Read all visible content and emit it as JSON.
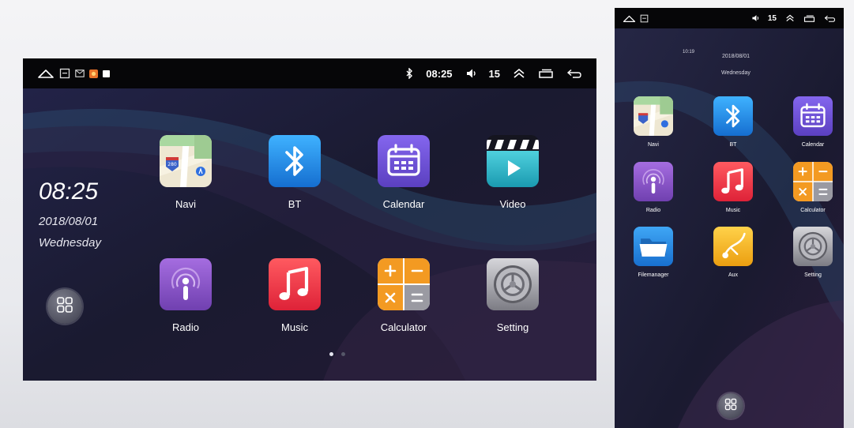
{
  "landscape": {
    "status": {
      "time": "08:25",
      "volume": "15"
    },
    "clock": {
      "time": "08:25",
      "date": "2018/08/01",
      "day": "Wednesday"
    },
    "apps": [
      {
        "label": "Navi",
        "icon": "map-icon"
      },
      {
        "label": "BT",
        "icon": "bluetooth-icon"
      },
      {
        "label": "Calendar",
        "icon": "calendar-icon"
      },
      {
        "label": "Video",
        "icon": "video-icon"
      },
      {
        "label": "Radio",
        "icon": "radio-icon"
      },
      {
        "label": "Music",
        "icon": "music-icon"
      },
      {
        "label": "Calculator",
        "icon": "calculator-icon"
      },
      {
        "label": "Setting",
        "icon": "settings-gear-icon"
      }
    ],
    "page_indicator": {
      "pages": 2,
      "current": 1
    }
  },
  "portrait": {
    "status": {
      "volume": "15"
    },
    "clock": {
      "time": "10:19",
      "date": "2018/08/01",
      "day": "Wednesday"
    },
    "apps": [
      {
        "label": "Navi",
        "icon": "map-icon"
      },
      {
        "label": "BT",
        "icon": "bluetooth-icon"
      },
      {
        "label": "Calendar",
        "icon": "calendar-icon"
      },
      {
        "label": "Radio",
        "icon": "radio-icon"
      },
      {
        "label": "Music",
        "icon": "music-icon"
      },
      {
        "label": "Calculator",
        "icon": "calculator-icon"
      },
      {
        "label": "Filemanager",
        "icon": "folder-icon"
      },
      {
        "label": "Aux",
        "icon": "aux-icon"
      },
      {
        "label": "Setting",
        "icon": "settings-gear-icon"
      }
    ]
  },
  "colors": {
    "status_bar": "#060608",
    "screen_background": "#191a2c",
    "bluetooth": "#1e90e6",
    "calendar": "#6a4fd1",
    "video": "#2fb6c9",
    "radio": "#8a52c8",
    "music": "#ee3a4a",
    "calculator_orange": "#f39a22",
    "filemanager": "#2a8be0",
    "aux": "#f2b21c"
  }
}
